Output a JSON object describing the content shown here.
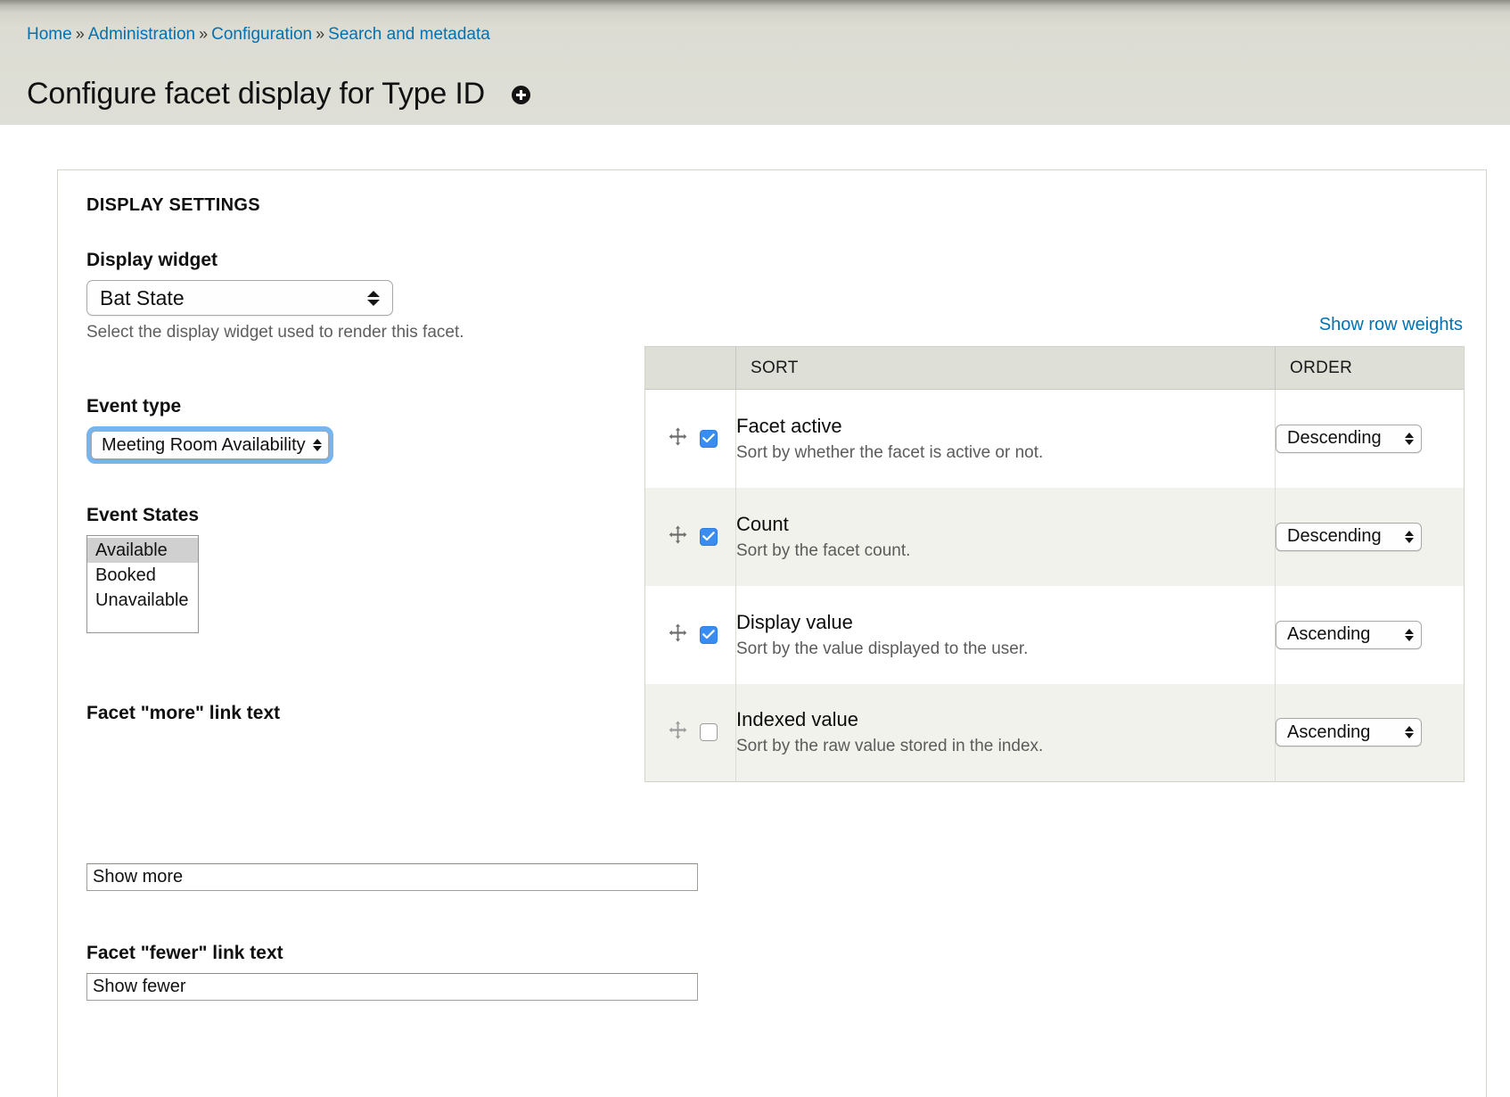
{
  "header": {
    "breadcrumb": [
      {
        "label": "Home"
      },
      {
        "label": "Administration"
      },
      {
        "label": "Configuration"
      },
      {
        "label": "Search and metadata"
      }
    ],
    "separator": "»",
    "title": "Configure facet display for Type ID",
    "help_icon": "plus-circle-icon"
  },
  "display_settings": {
    "section_title": "DISPLAY SETTINGS",
    "display_widget": {
      "label": "Display widget",
      "value": "Bat State",
      "description": "Select the display widget used to render this facet."
    },
    "event_type": {
      "label": "Event type",
      "value": "Meeting Room Availability"
    },
    "event_states": {
      "label": "Event States",
      "options": [
        "Available",
        "Booked",
        "Unavailable"
      ],
      "selected": "Available"
    },
    "more_link": {
      "label": "Facet \"more\" link text",
      "value": "Show more"
    },
    "fewer_link": {
      "label": "Facet \"fewer\" link text",
      "value": "Show fewer"
    }
  },
  "sorts": {
    "show_row_weights": "Show row weights",
    "columns": {
      "handle": "",
      "sort": "SORT",
      "order": "ORDER"
    },
    "rows": [
      {
        "name": "Facet active",
        "description": "Sort by whether the facet is active or not.",
        "checked": true,
        "order": "Descending",
        "handle_icon": "drag-move-icon"
      },
      {
        "name": "Count",
        "description": "Sort by the facet count.",
        "checked": true,
        "order": "Descending",
        "handle_icon": "drag-move-icon"
      },
      {
        "name": "Display value",
        "description": "Sort by the value displayed to the user.",
        "checked": true,
        "order": "Ascending",
        "handle_icon": "drag-move-icon"
      },
      {
        "name": "Indexed value",
        "description": "Sort by the raw value stored in the index.",
        "checked": false,
        "order": "Ascending",
        "handle_icon": "drag-move-icon"
      }
    ]
  },
  "colors": {
    "link": "#0071b3",
    "header_bg": "#dedfd6",
    "checkbox_checked": "#3b8cf0",
    "focus_ring": "#76b6f0",
    "row_even": "#f2f2ec"
  }
}
